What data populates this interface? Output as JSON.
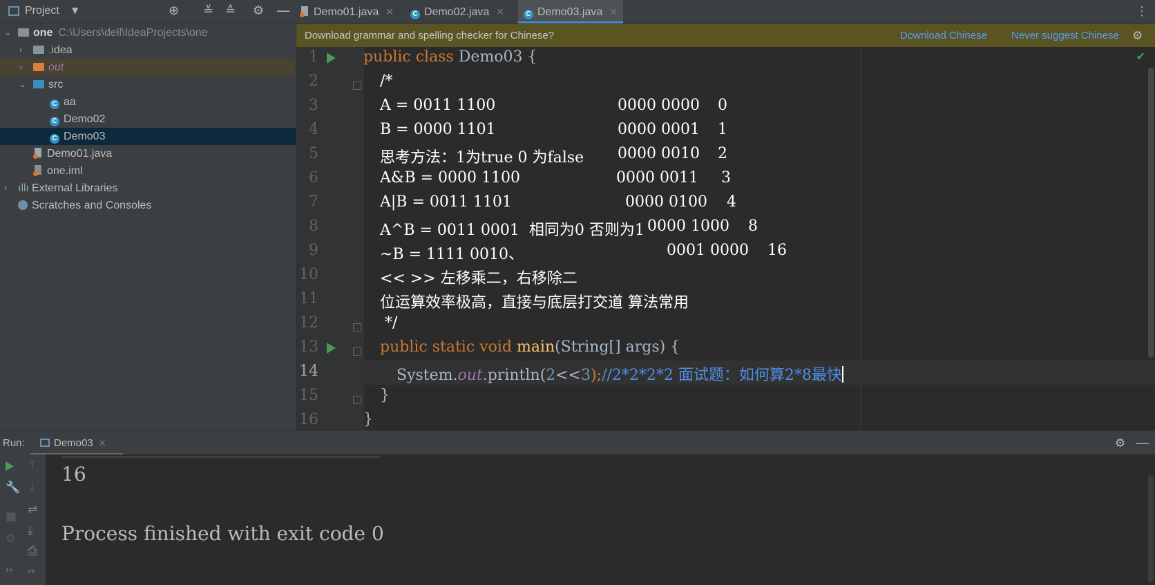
{
  "project_panel": {
    "title": "Project"
  },
  "tabs": [
    {
      "label": "Demo01.java",
      "active": false
    },
    {
      "label": "Demo02.java",
      "active": false
    },
    {
      "label": "Demo03.java",
      "active": true
    }
  ],
  "tree": {
    "root": {
      "name": "one",
      "path": "C:\\Users\\dell\\IdeaProjects\\one"
    },
    "items": [
      {
        "label": ".idea"
      },
      {
        "label": "out"
      },
      {
        "label": "src"
      },
      {
        "label": "aa"
      },
      {
        "label": "Demo02"
      },
      {
        "label": "Demo03"
      },
      {
        "label": "Demo01.java"
      },
      {
        "label": "one.iml"
      },
      {
        "label": "External Libraries"
      },
      {
        "label": "Scratches and Consoles"
      }
    ]
  },
  "notification": {
    "message": "Download grammar and spelling checker for Chinese?",
    "action1": "Download Chinese",
    "action2": "Never suggest Chinese"
  },
  "editor": {
    "line_numbers": [
      "1",
      "2",
      "3",
      "4",
      "5",
      "6",
      "7",
      "8",
      "9",
      "10",
      "11",
      "12",
      "13",
      "14",
      "15",
      "16"
    ],
    "l1_kw": "public class ",
    "l1_name": "Demo03 {",
    "l2": "/*",
    "l3a": "A = 0011 1100",
    "l3b": "0000 0000",
    "l3c": "0",
    "l4a": "B = 0000 1101",
    "l4b": "0000 0001",
    "l4c": "1",
    "l5a": "思考方法：1为true 0 为false",
    "l5b": "0000 0010",
    "l5c": "2",
    "l6a": "A&B = 0000 1100",
    "l6b": "0000 0011",
    "l6c": "3",
    "l7a": "A|B = 0011 1101",
    "l7b": "0000 0100",
    "l7c": "4",
    "l8a": "A^B = 0011 0001  相同为0 否则为1",
    "l8b": "0000 1000",
    "l8c": "8",
    "l9a": "~B = 1111 0010、",
    "l9b": "0001 0000",
    "l9c": "16",
    "l10": "<< >> 左移乘二，右移除二",
    "l11": "位运算效率极高，直接与底层打交道 算法常用",
    "l12": " */",
    "l13_kw": "public static void ",
    "l13_m": "main",
    "l13_rest": "(String[] args) {",
    "l14_sys": "System.",
    "l14_out": "out",
    "l14_p": ".println(",
    "l14_n1": "2",
    "l14_op": "<<",
    "l14_n2": "3",
    "l14_end": ");",
    "l14_cmt": "//2*2*2*2 面试题：如何算2*8最快",
    "l15": "}",
    "l16": "}"
  },
  "run": {
    "label": "Run:",
    "tab": "Demo03",
    "output_line1": "16",
    "output_line2": "Process finished with exit code 0"
  }
}
